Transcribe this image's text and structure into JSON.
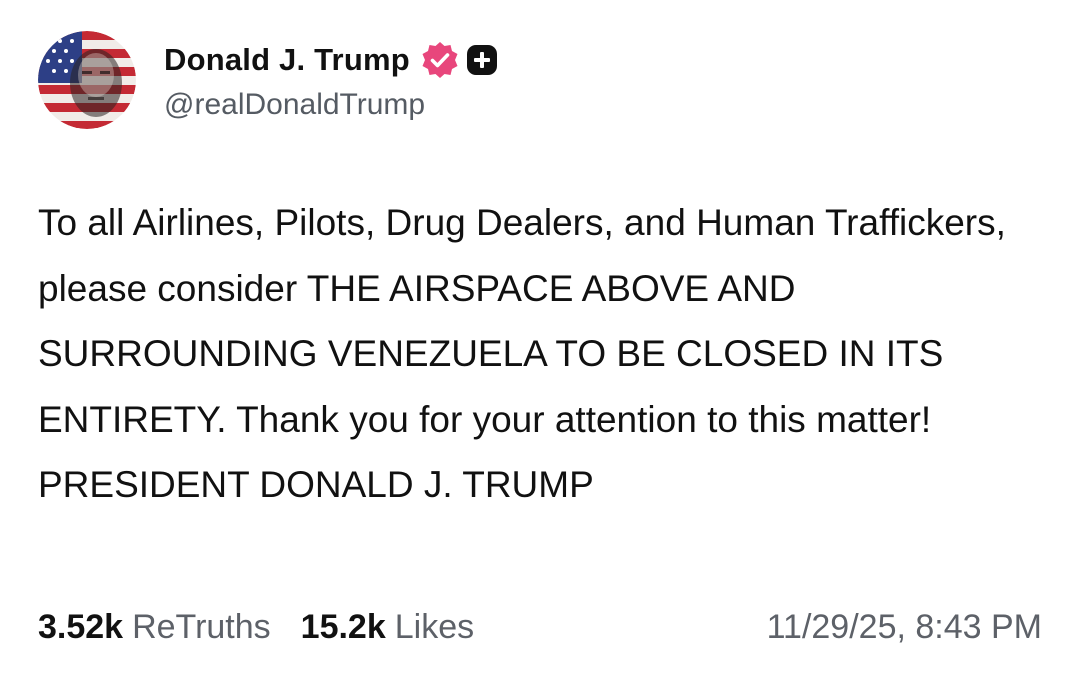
{
  "author": {
    "display_name": "Donald J. Trump",
    "handle": "@realDonaldTrump",
    "verified_color": "#e8467c",
    "badge_icons": [
      "verified-icon",
      "plus-icon"
    ]
  },
  "post": {
    "text": "To all Airlines, Pilots, Drug Dealers, and Human Traffickers, please consider THE AIRSPACE ABOVE AND SURROUNDING VENEZUELA TO BE CLOSED IN ITS ENTIRETY. Thank you for your attention to this matter! PRESIDENT DONALD J. TRUMP"
  },
  "stats": {
    "retruths_count": "3.52k",
    "retruths_label": "ReTruths",
    "likes_count": "15.2k",
    "likes_label": "Likes"
  },
  "timestamp": "11/29/25, 8:43 PM"
}
